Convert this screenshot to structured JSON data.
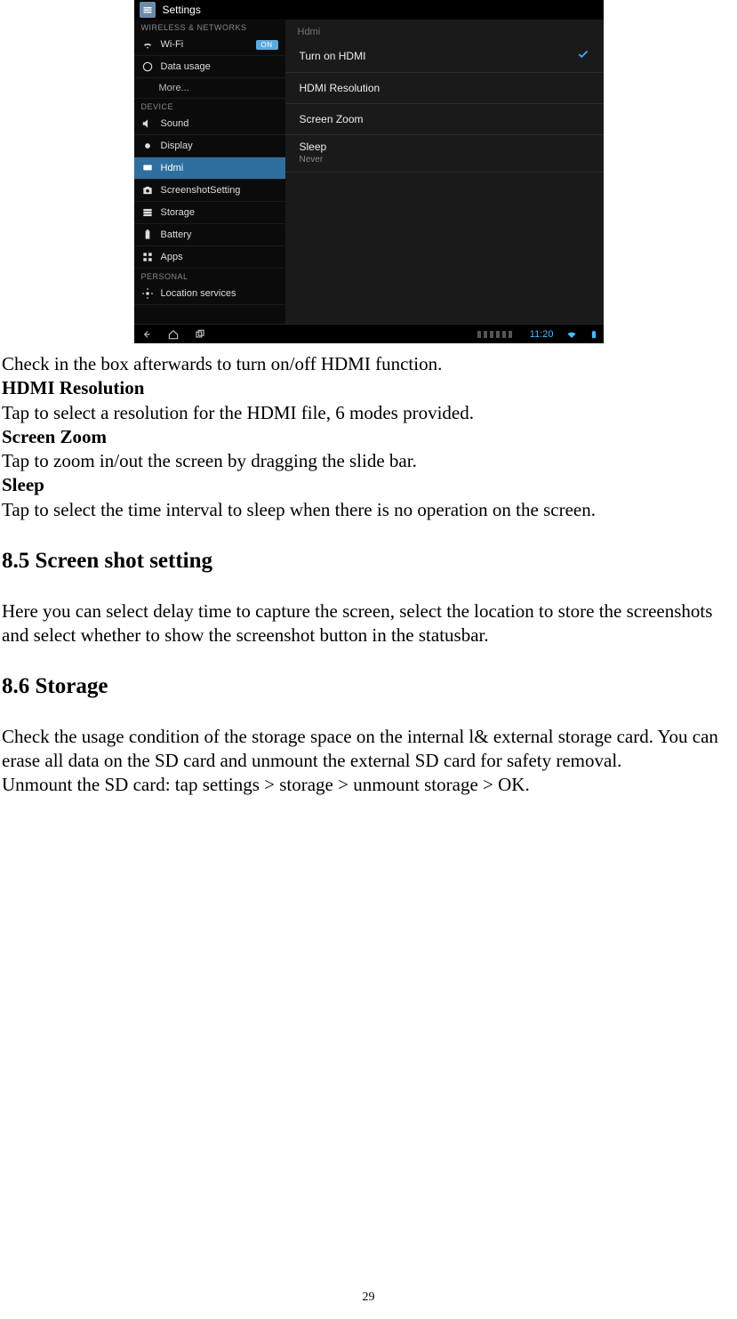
{
  "screenshot": {
    "app_title": "Settings",
    "sections": {
      "wireless": "WIRELESS & NETWORKS",
      "device": "DEVICE",
      "personal": "PERSONAL"
    },
    "sidebar": {
      "wifi": "Wi-Fi",
      "wifi_toggle": "ON",
      "data_usage": "Data usage",
      "more": "More...",
      "sound": "Sound",
      "display": "Display",
      "hdmi": "Hdmi",
      "screenshot_setting": "ScreenshotSetting",
      "storage": "Storage",
      "battery": "Battery",
      "apps": "Apps",
      "location": "Location services"
    },
    "pane": {
      "breadcrumb": "Hdmi",
      "turn_on": "Turn on HDMI",
      "resolution": "HDMI Resolution",
      "zoom": "Screen Zoom",
      "sleep_label": "Sleep",
      "sleep_value": "Never"
    },
    "navbar_time": "11:20"
  },
  "doc": {
    "p1": "Check in the box afterwards to turn on/off HDMI function.",
    "h_res": "HDMI Resolution",
    "p_res": "Tap to select a resolution for the HDMI file, 6 modes provided.",
    "h_zoom": "Screen Zoom",
    "p_zoom": "Tap to zoom in/out the screen by dragging the slide bar.",
    "h_sleep": "Sleep",
    "p_sleep": "Tap to select the time interval to sleep when there is no operation on the screen.",
    "h85": "8.5 Screen shot setting",
    "p85": "Here you can select delay time to capture the screen, select the location to store the screenshots and select whether to show the screenshot button in the statusbar.",
    "h86": "8.6 Storage",
    "p86a": "Check the usage condition of the storage space on the internal l& external storage card. You can erase all data on the SD card and unmount the external SD card for safety removal.",
    "p86b": "Unmount the SD card: tap settings > storage > unmount storage > OK.",
    "page_number": "29"
  }
}
